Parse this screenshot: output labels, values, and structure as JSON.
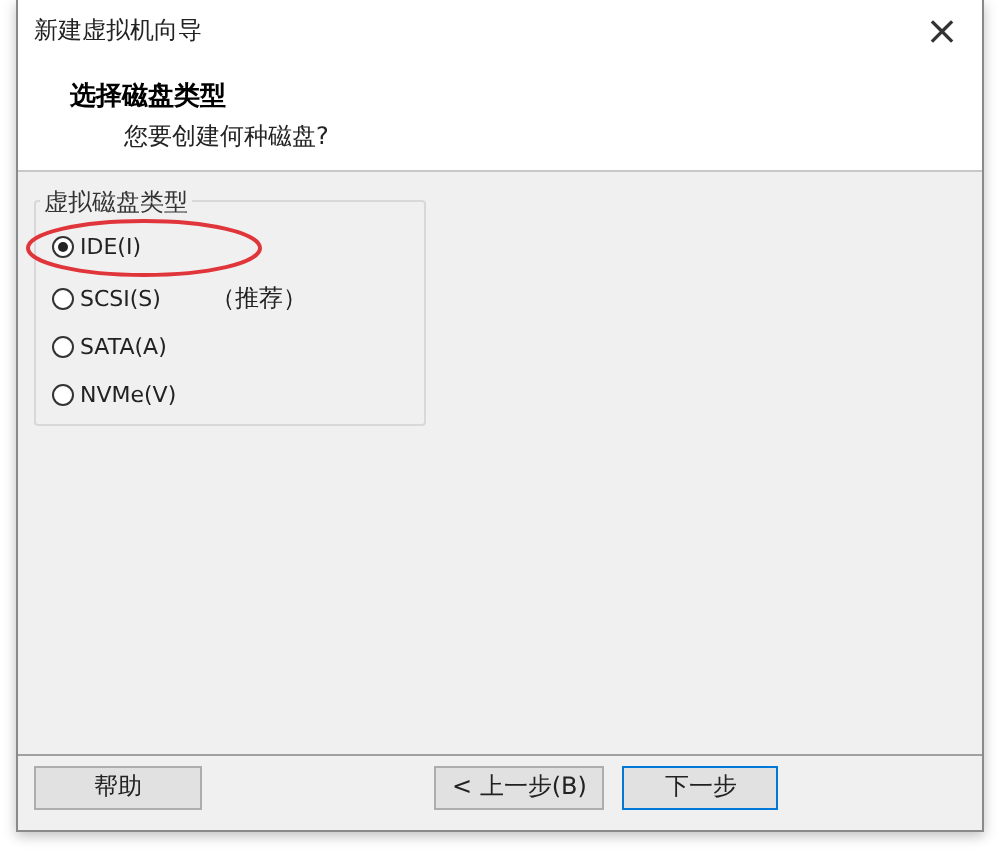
{
  "window": {
    "title": "新建虚拟机向导",
    "close": "×"
  },
  "header": {
    "title": "选择磁盘类型",
    "subtitle": "您要创建何种磁盘?"
  },
  "group": {
    "label": "虚拟磁盘类型",
    "options": [
      {
        "label": "IDE(I)",
        "selected": true,
        "highlighted": true
      },
      {
        "label": "SCSI(S)",
        "selected": false,
        "note": "（推荐）"
      },
      {
        "label": "SATA(A)",
        "selected": false
      },
      {
        "label": "NVMe(V)",
        "selected": false
      }
    ]
  },
  "buttons": [
    {
      "label": "帮助",
      "kind": "help"
    },
    {
      "label": "< 上一步(B)",
      "kind": "back"
    },
    {
      "label": "下一步",
      "kind": "next",
      "default": true
    }
  ]
}
